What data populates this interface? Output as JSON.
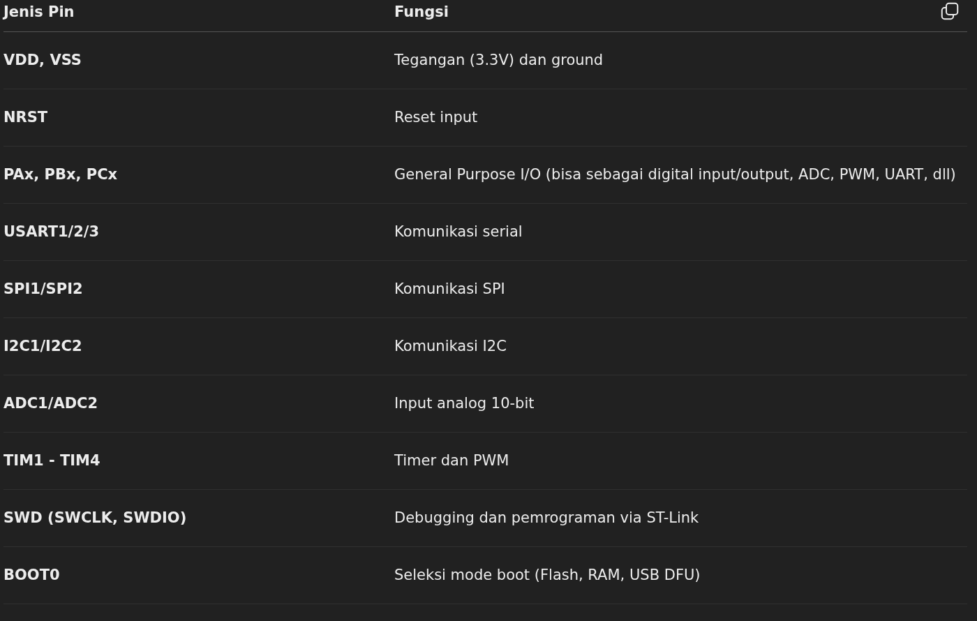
{
  "table": {
    "columns": [
      "Jenis Pin",
      "Fungsi"
    ],
    "rows": [
      {
        "pin": "VDD, VSS",
        "function": "Tegangan (3.3V) dan ground"
      },
      {
        "pin": "NRST",
        "function": "Reset input"
      },
      {
        "pin": "PAx, PBx, PCx",
        "function": "General Purpose I/O (bisa sebagai digital input/output, ADC, PWM, UART, dll)"
      },
      {
        "pin": "USART1/2/3",
        "function": "Komunikasi serial"
      },
      {
        "pin": "SPI1/SPI2",
        "function": "Komunikasi SPI"
      },
      {
        "pin": "I2C1/I2C2",
        "function": "Komunikasi I2C"
      },
      {
        "pin": "ADC1/ADC2",
        "function": "Input analog 10-bit"
      },
      {
        "pin": "TIM1 - TIM4",
        "function": "Timer dan PWM"
      },
      {
        "pin": "SWD (SWCLK, SWDIO)",
        "function": "Debugging dan pemrograman via ST-Link"
      },
      {
        "pin": "BOOT0",
        "function": "Seleksi mode boot (Flash, RAM, USB DFU)"
      }
    ]
  }
}
